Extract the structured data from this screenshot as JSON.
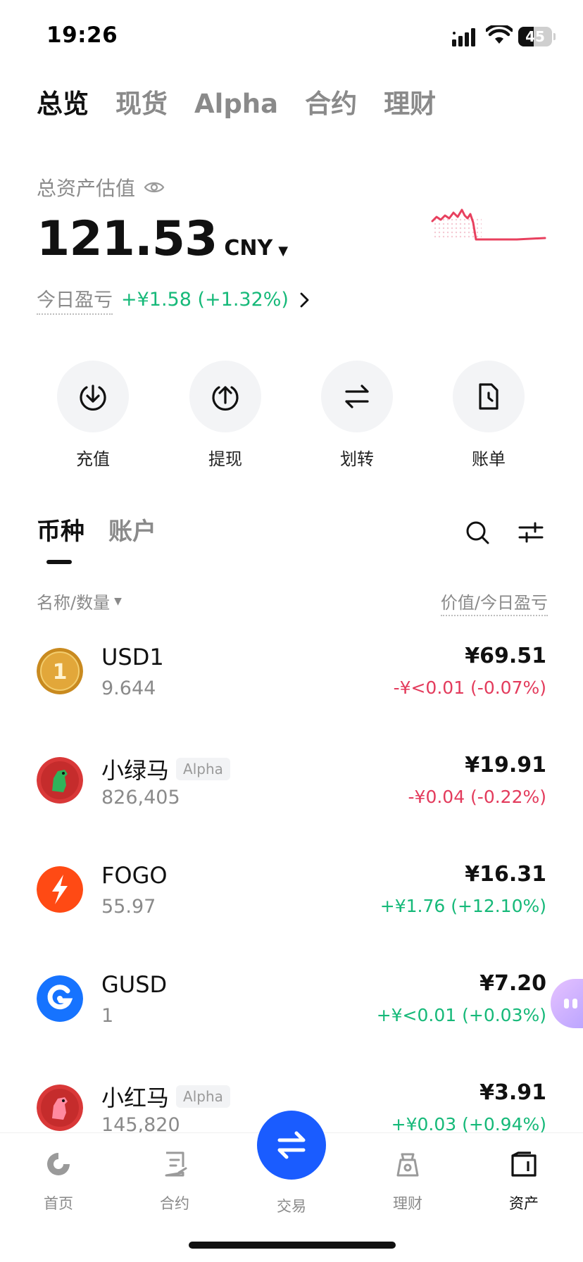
{
  "status_bar": {
    "time": "19:26",
    "battery": "45",
    "battery_level": 0.45
  },
  "top_tabs": [
    {
      "label": "总览",
      "active": true
    },
    {
      "label": "现货",
      "active": false
    },
    {
      "label": "Alpha",
      "active": false
    },
    {
      "label": "合约",
      "active": false
    },
    {
      "label": "理财",
      "active": false
    }
  ],
  "overview": {
    "asset_label": "总资产估值",
    "balance": "121.53",
    "currency": "CNY",
    "pnl_label": "今日盈亏",
    "pnl_value": "+¥1.58 (+1.32%)"
  },
  "actions": [
    {
      "label": "充值",
      "icon": "deposit-icon"
    },
    {
      "label": "提现",
      "icon": "withdraw-icon"
    },
    {
      "label": "划转",
      "icon": "transfer-icon"
    },
    {
      "label": "账单",
      "icon": "bill-icon"
    }
  ],
  "asset_tabs": [
    {
      "label": "币种",
      "active": true
    },
    {
      "label": "账户",
      "active": false
    }
  ],
  "list_header": {
    "left": "名称/数量",
    "right": "价值/今日盈亏"
  },
  "coins": [
    {
      "name": "USD1",
      "tag": "",
      "qty": "9.644",
      "value": "¥69.51",
      "change": "-¥<0.01 (-0.07%)",
      "trend": "neg"
    },
    {
      "name": "小绿马",
      "tag": "Alpha",
      "qty": "826,405",
      "value": "¥19.91",
      "change": "-¥0.04 (-0.22%)",
      "trend": "neg"
    },
    {
      "name": "FOGO",
      "tag": "",
      "qty": "55.97",
      "value": "¥16.31",
      "change": "+¥1.76 (+12.10%)",
      "trend": "pos"
    },
    {
      "name": "GUSD",
      "tag": "",
      "qty": "1",
      "value": "¥7.20",
      "change": "+¥<0.01 (+0.03%)",
      "trend": "pos"
    },
    {
      "name": "小红马",
      "tag": "Alpha",
      "qty": "145,820",
      "value": "¥3.91",
      "change": "+¥0.03 (+0.94%)",
      "trend": "pos"
    }
  ],
  "bottom_nav": [
    {
      "label": "首页",
      "active": false
    },
    {
      "label": "合约",
      "active": false
    },
    {
      "label": "交易",
      "active": false
    },
    {
      "label": "理财",
      "active": false
    },
    {
      "label": "资产",
      "active": true
    }
  ],
  "colors": {
    "positive": "#16b979",
    "negative": "#e33b5c",
    "accent": "#1a5cff"
  }
}
